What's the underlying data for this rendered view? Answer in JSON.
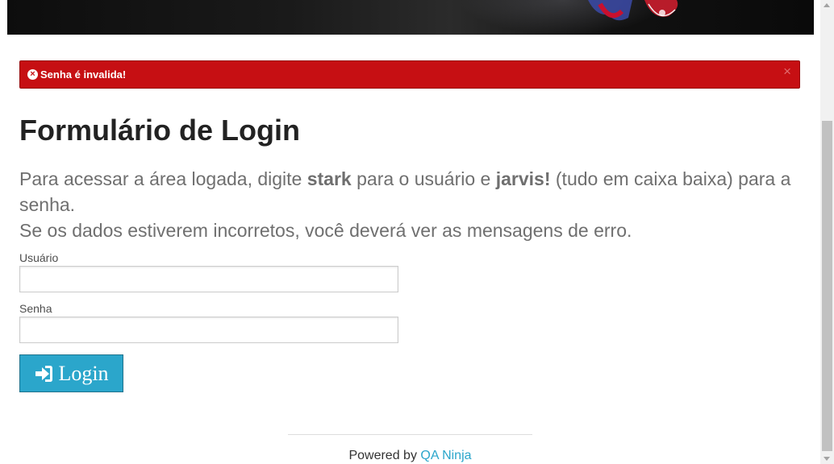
{
  "alert": {
    "message": "Senha é invalida!",
    "close_symbol": "×",
    "icon": "x-circle-icon",
    "color": "#c60f13"
  },
  "page": {
    "title": "Formulário de Login",
    "intro_part1": "Para acessar a área logada, digite ",
    "intro_user": "stark",
    "intro_part2": " para o usuário e ",
    "intro_pass": "jarvis!",
    "intro_part3": " (tudo em caixa baixa) para a senha.",
    "intro_line2": "Se os dados estiverem incorretos, você deverá ver as mensagens de erro."
  },
  "form": {
    "username_label": "Usuário",
    "username_value": "",
    "password_label": "Senha",
    "password_value": "",
    "submit_label": "Login",
    "submit_icon": "sign-in-icon",
    "button_color": "#2ba6cb"
  },
  "footer": {
    "prefix": "Powered by ",
    "link_text": "QA Ninja",
    "link_color": "#2ba6cb"
  }
}
